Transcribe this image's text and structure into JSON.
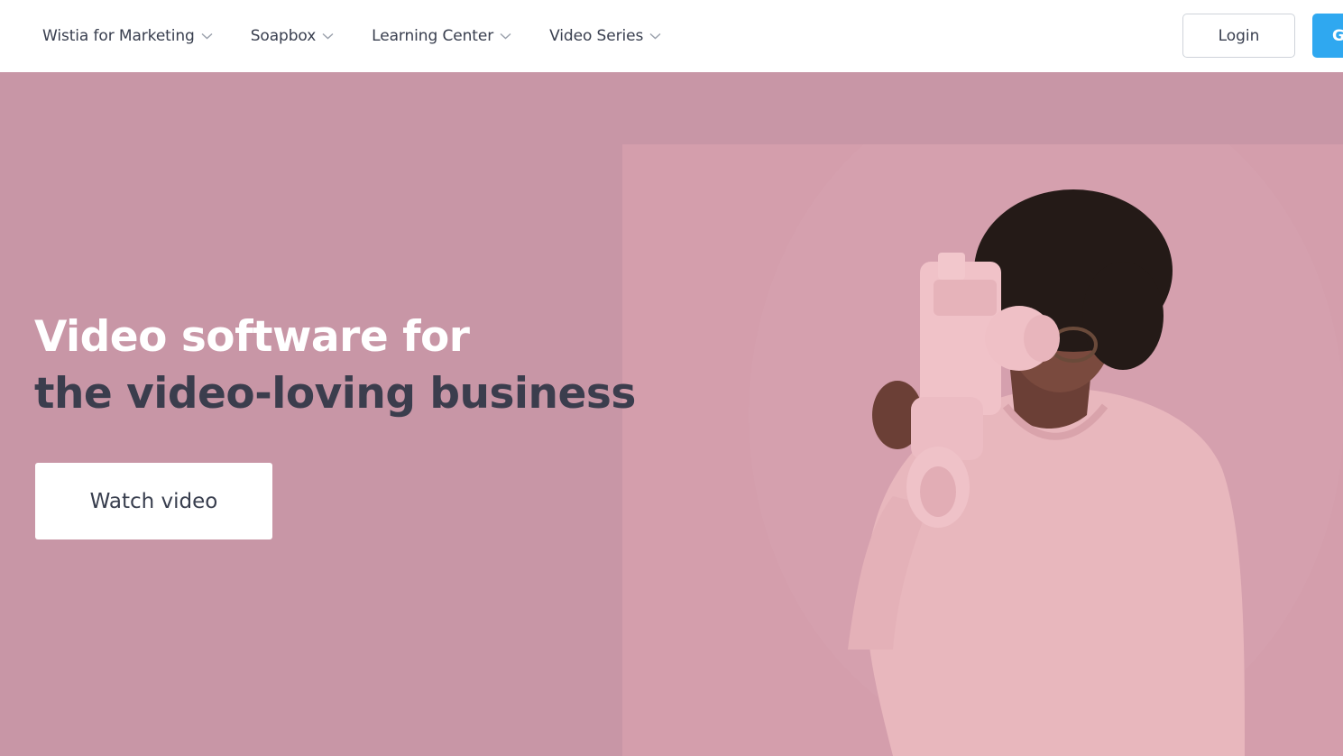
{
  "nav": {
    "items": [
      {
        "label": "Wistia for Marketing",
        "icon": "chevron-down-icon"
      },
      {
        "label": "Soapbox",
        "icon": "chevron-down-icon"
      },
      {
        "label": "Learning Center",
        "icon": "chevron-down-icon"
      },
      {
        "label": "Video Series",
        "icon": "chevron-down-icon"
      }
    ],
    "login_label": "Login",
    "cta_label": "G"
  },
  "hero": {
    "headline_line1": "Video software for",
    "headline_line2": "the video-loving business",
    "watch_label": "Watch video",
    "video_subject": "woman-with-pink-camera"
  },
  "colors": {
    "hero_bg": "#c896a6",
    "video_bg": "#d49eac",
    "cta_blue": "#2fa8f0",
    "headline_white": "#ffffff",
    "headline_dark": "#3b3d4d",
    "nav_text": "#383e4e"
  }
}
